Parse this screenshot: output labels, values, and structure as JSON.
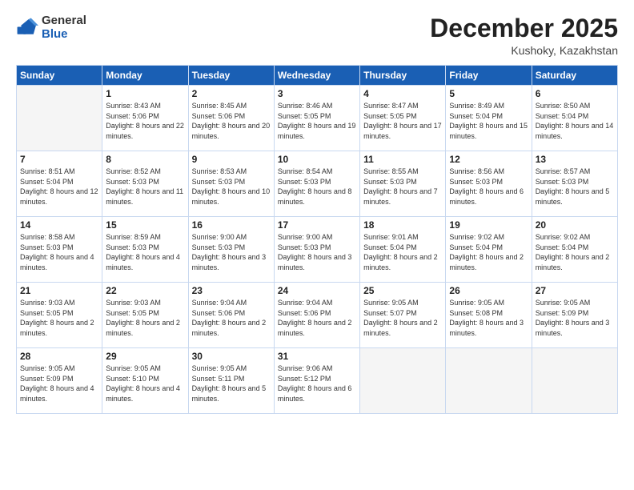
{
  "logo": {
    "general": "General",
    "blue": "Blue"
  },
  "header": {
    "month": "December 2025",
    "location": "Kushoky, Kazakhstan"
  },
  "weekdays": [
    "Sunday",
    "Monday",
    "Tuesday",
    "Wednesday",
    "Thursday",
    "Friday",
    "Saturday"
  ],
  "weeks": [
    [
      {
        "day": "",
        "sunrise": "",
        "sunset": "",
        "daylight": ""
      },
      {
        "day": "1",
        "sunrise": "Sunrise: 8:43 AM",
        "sunset": "Sunset: 5:06 PM",
        "daylight": "Daylight: 8 hours and 22 minutes."
      },
      {
        "day": "2",
        "sunrise": "Sunrise: 8:45 AM",
        "sunset": "Sunset: 5:06 PM",
        "daylight": "Daylight: 8 hours and 20 minutes."
      },
      {
        "day": "3",
        "sunrise": "Sunrise: 8:46 AM",
        "sunset": "Sunset: 5:05 PM",
        "daylight": "Daylight: 8 hours and 19 minutes."
      },
      {
        "day": "4",
        "sunrise": "Sunrise: 8:47 AM",
        "sunset": "Sunset: 5:05 PM",
        "daylight": "Daylight: 8 hours and 17 minutes."
      },
      {
        "day": "5",
        "sunrise": "Sunrise: 8:49 AM",
        "sunset": "Sunset: 5:04 PM",
        "daylight": "Daylight: 8 hours and 15 minutes."
      },
      {
        "day": "6",
        "sunrise": "Sunrise: 8:50 AM",
        "sunset": "Sunset: 5:04 PM",
        "daylight": "Daylight: 8 hours and 14 minutes."
      }
    ],
    [
      {
        "day": "7",
        "sunrise": "Sunrise: 8:51 AM",
        "sunset": "Sunset: 5:04 PM",
        "daylight": "Daylight: 8 hours and 12 minutes."
      },
      {
        "day": "8",
        "sunrise": "Sunrise: 8:52 AM",
        "sunset": "Sunset: 5:03 PM",
        "daylight": "Daylight: 8 hours and 11 minutes."
      },
      {
        "day": "9",
        "sunrise": "Sunrise: 8:53 AM",
        "sunset": "Sunset: 5:03 PM",
        "daylight": "Daylight: 8 hours and 10 minutes."
      },
      {
        "day": "10",
        "sunrise": "Sunrise: 8:54 AM",
        "sunset": "Sunset: 5:03 PM",
        "daylight": "Daylight: 8 hours and 8 minutes."
      },
      {
        "day": "11",
        "sunrise": "Sunrise: 8:55 AM",
        "sunset": "Sunset: 5:03 PM",
        "daylight": "Daylight: 8 hours and 7 minutes."
      },
      {
        "day": "12",
        "sunrise": "Sunrise: 8:56 AM",
        "sunset": "Sunset: 5:03 PM",
        "daylight": "Daylight: 8 hours and 6 minutes."
      },
      {
        "day": "13",
        "sunrise": "Sunrise: 8:57 AM",
        "sunset": "Sunset: 5:03 PM",
        "daylight": "Daylight: 8 hours and 5 minutes."
      }
    ],
    [
      {
        "day": "14",
        "sunrise": "Sunrise: 8:58 AM",
        "sunset": "Sunset: 5:03 PM",
        "daylight": "Daylight: 8 hours and 4 minutes."
      },
      {
        "day": "15",
        "sunrise": "Sunrise: 8:59 AM",
        "sunset": "Sunset: 5:03 PM",
        "daylight": "Daylight: 8 hours and 4 minutes."
      },
      {
        "day": "16",
        "sunrise": "Sunrise: 9:00 AM",
        "sunset": "Sunset: 5:03 PM",
        "daylight": "Daylight: 8 hours and 3 minutes."
      },
      {
        "day": "17",
        "sunrise": "Sunrise: 9:00 AM",
        "sunset": "Sunset: 5:03 PM",
        "daylight": "Daylight: 8 hours and 3 minutes."
      },
      {
        "day": "18",
        "sunrise": "Sunrise: 9:01 AM",
        "sunset": "Sunset: 5:04 PM",
        "daylight": "Daylight: 8 hours and 2 minutes."
      },
      {
        "day": "19",
        "sunrise": "Sunrise: 9:02 AM",
        "sunset": "Sunset: 5:04 PM",
        "daylight": "Daylight: 8 hours and 2 minutes."
      },
      {
        "day": "20",
        "sunrise": "Sunrise: 9:02 AM",
        "sunset": "Sunset: 5:04 PM",
        "daylight": "Daylight: 8 hours and 2 minutes."
      }
    ],
    [
      {
        "day": "21",
        "sunrise": "Sunrise: 9:03 AM",
        "sunset": "Sunset: 5:05 PM",
        "daylight": "Daylight: 8 hours and 2 minutes."
      },
      {
        "day": "22",
        "sunrise": "Sunrise: 9:03 AM",
        "sunset": "Sunset: 5:05 PM",
        "daylight": "Daylight: 8 hours and 2 minutes."
      },
      {
        "day": "23",
        "sunrise": "Sunrise: 9:04 AM",
        "sunset": "Sunset: 5:06 PM",
        "daylight": "Daylight: 8 hours and 2 minutes."
      },
      {
        "day": "24",
        "sunrise": "Sunrise: 9:04 AM",
        "sunset": "Sunset: 5:06 PM",
        "daylight": "Daylight: 8 hours and 2 minutes."
      },
      {
        "day": "25",
        "sunrise": "Sunrise: 9:05 AM",
        "sunset": "Sunset: 5:07 PM",
        "daylight": "Daylight: 8 hours and 2 minutes."
      },
      {
        "day": "26",
        "sunrise": "Sunrise: 9:05 AM",
        "sunset": "Sunset: 5:08 PM",
        "daylight": "Daylight: 8 hours and 3 minutes."
      },
      {
        "day": "27",
        "sunrise": "Sunrise: 9:05 AM",
        "sunset": "Sunset: 5:09 PM",
        "daylight": "Daylight: 8 hours and 3 minutes."
      }
    ],
    [
      {
        "day": "28",
        "sunrise": "Sunrise: 9:05 AM",
        "sunset": "Sunset: 5:09 PM",
        "daylight": "Daylight: 8 hours and 4 minutes."
      },
      {
        "day": "29",
        "sunrise": "Sunrise: 9:05 AM",
        "sunset": "Sunset: 5:10 PM",
        "daylight": "Daylight: 8 hours and 4 minutes."
      },
      {
        "day": "30",
        "sunrise": "Sunrise: 9:05 AM",
        "sunset": "Sunset: 5:11 PM",
        "daylight": "Daylight: 8 hours and 5 minutes."
      },
      {
        "day": "31",
        "sunrise": "Sunrise: 9:06 AM",
        "sunset": "Sunset: 5:12 PM",
        "daylight": "Daylight: 8 hours and 6 minutes."
      },
      {
        "day": "",
        "sunrise": "",
        "sunset": "",
        "daylight": ""
      },
      {
        "day": "",
        "sunrise": "",
        "sunset": "",
        "daylight": ""
      },
      {
        "day": "",
        "sunrise": "",
        "sunset": "",
        "daylight": ""
      }
    ]
  ]
}
